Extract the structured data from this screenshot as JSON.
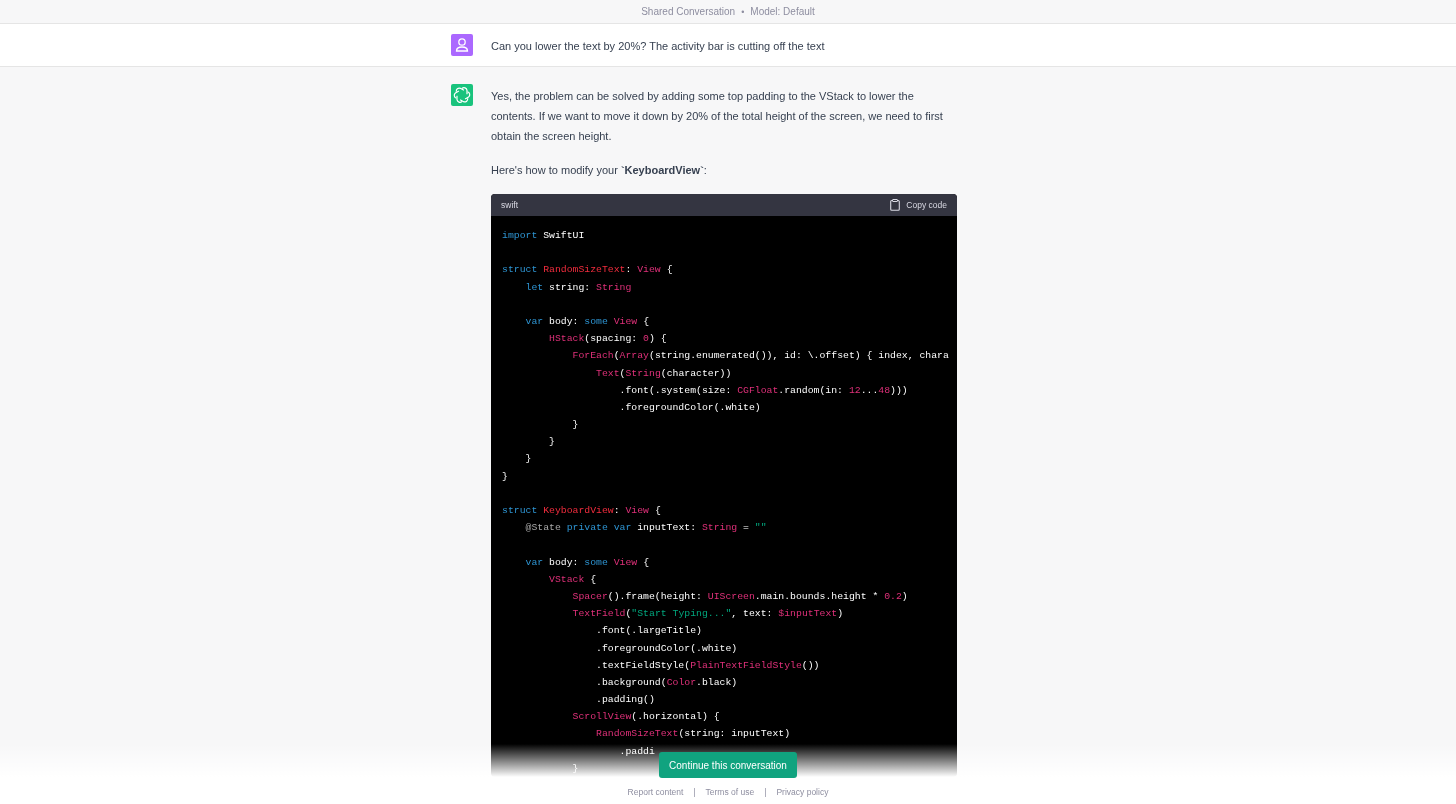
{
  "header": {
    "title": "Shared Conversation",
    "separator": "•",
    "model": "Model: Default"
  },
  "messages": [
    {
      "kind": "user",
      "paragraphs": [
        "Can you lower the text by 20%? The activity bar is cutting off the text"
      ]
    },
    {
      "kind": "assistant",
      "paragraphs": [
        "Yes, the problem can be solved by adding some top padding to the VStack to lower the contents. If we want to move it down by 20% of the total height of the screen, we need to first obtain the screen height.",
        "Here's how to modify your **`KeyboardView`**:"
      ],
      "code": {
        "language": "swift",
        "copy_label": "Copy code",
        "lines": [
          {
            "kind": "code",
            "tokens": [
              {
                "text": "import",
                "kind": "keyword"
              },
              {
                "text": " SwiftUI",
                "kind": "plain"
              }
            ]
          },
          {
            "kind": "blank"
          },
          {
            "kind": "code",
            "tokens": [
              {
                "text": "struct ",
                "kind": "keyword"
              },
              {
                "text": "RandomSizeText",
                "kind": "title"
              },
              {
                "text": ": ",
                "kind": "plain"
              },
              {
                "text": "View",
                "kind": "type"
              },
              {
                "text": " {",
                "kind": "plain"
              }
            ]
          },
          {
            "kind": "code",
            "tokens": [
              {
                "text": "    let",
                "kind": "keyword"
              },
              {
                "text": " string: ",
                "kind": "plain"
              },
              {
                "text": "String",
                "kind": "type"
              }
            ]
          },
          {
            "kind": "blank"
          },
          {
            "kind": "code",
            "tokens": [
              {
                "text": "    var",
                "kind": "keyword"
              },
              {
                "text": " body: ",
                "kind": "plain"
              },
              {
                "text": "some ",
                "kind": "keyword"
              },
              {
                "text": "View",
                "kind": "type"
              },
              {
                "text": " {",
                "kind": "plain"
              }
            ]
          },
          {
            "kind": "code",
            "tokens": [
              {
                "text": "        HStack",
                "kind": "type"
              },
              {
                "text": "(spacing: ",
                "kind": "plain"
              },
              {
                "text": "0",
                "kind": "type"
              },
              {
                "text": ") {",
                "kind": "plain"
              }
            ]
          },
          {
            "kind": "code",
            "tokens": [
              {
                "text": "            ForEach",
                "kind": "type"
              },
              {
                "text": "(",
                "kind": "plain"
              },
              {
                "text": "Array",
                "kind": "type"
              },
              {
                "text": "(string.enumerated()), id: \\.offset) { index, chara",
                "kind": "plain"
              }
            ]
          },
          {
            "kind": "code",
            "tokens": [
              {
                "text": "                Text",
                "kind": "type"
              },
              {
                "text": "(",
                "kind": "plain"
              },
              {
                "text": "String",
                "kind": "type"
              },
              {
                "text": "(character))",
                "kind": "plain"
              }
            ]
          },
          {
            "kind": "code",
            "tokens": [
              {
                "text": "                    .font(.system(size: ",
                "kind": "plain"
              },
              {
                "text": "CGFloat",
                "kind": "type"
              },
              {
                "text": ".random(in: ",
                "kind": "plain"
              },
              {
                "text": "12",
                "kind": "type"
              },
              {
                "text": "...",
                "kind": "plain"
              },
              {
                "text": "48",
                "kind": "type"
              },
              {
                "text": ")))",
                "kind": "plain"
              }
            ]
          },
          {
            "kind": "code",
            "tokens": [
              {
                "text": "                    .foregroundColor(.white)",
                "kind": "plain"
              }
            ]
          },
          {
            "kind": "code",
            "tokens": [
              {
                "text": "            }",
                "kind": "plain"
              }
            ]
          },
          {
            "kind": "code",
            "tokens": [
              {
                "text": "        }",
                "kind": "plain"
              }
            ]
          },
          {
            "kind": "code",
            "tokens": [
              {
                "text": "    }",
                "kind": "plain"
              }
            ]
          },
          {
            "kind": "code",
            "tokens": [
              {
                "text": "}",
                "kind": "plain"
              }
            ]
          },
          {
            "kind": "blank"
          },
          {
            "kind": "code",
            "tokens": [
              {
                "text": "struct ",
                "kind": "keyword"
              },
              {
                "text": "KeyboardView",
                "kind": "title"
              },
              {
                "text": ": ",
                "kind": "plain"
              },
              {
                "text": "View",
                "kind": "type"
              },
              {
                "text": " {",
                "kind": "plain"
              }
            ]
          },
          {
            "kind": "code",
            "tokens": [
              {
                "text": "    @State ",
                "kind": "meta"
              },
              {
                "text": "private var",
                "kind": "keyword"
              },
              {
                "text": " inputText: ",
                "kind": "plain"
              },
              {
                "text": "String",
                "kind": "type"
              },
              {
                "text": " = ",
                "kind": "plain"
              },
              {
                "text": "\"\"",
                "kind": "string"
              }
            ]
          },
          {
            "kind": "blank"
          },
          {
            "kind": "code",
            "tokens": [
              {
                "text": "    var",
                "kind": "keyword"
              },
              {
                "text": " body: ",
                "kind": "plain"
              },
              {
                "text": "some ",
                "kind": "keyword"
              },
              {
                "text": "View",
                "kind": "type"
              },
              {
                "text": " {",
                "kind": "plain"
              }
            ]
          },
          {
            "kind": "code",
            "tokens": [
              {
                "text": "        VStack",
                "kind": "type"
              },
              {
                "text": " {",
                "kind": "plain"
              }
            ]
          },
          {
            "kind": "code",
            "tokens": [
              {
                "text": "            Spacer",
                "kind": "type"
              },
              {
                "text": "().frame(height: ",
                "kind": "plain"
              },
              {
                "text": "UIScreen",
                "kind": "type"
              },
              {
                "text": ".main.bounds.height * ",
                "kind": "plain"
              },
              {
                "text": "0.2",
                "kind": "type"
              },
              {
                "text": ")",
                "kind": "plain"
              }
            ]
          },
          {
            "kind": "code",
            "tokens": [
              {
                "text": "            TextField",
                "kind": "type"
              },
              {
                "text": "(",
                "kind": "plain"
              },
              {
                "text": "\"Start Typing...\"",
                "kind": "string"
              },
              {
                "text": ", text: ",
                "kind": "plain"
              },
              {
                "text": "$inputText",
                "kind": "type"
              },
              {
                "text": ")",
                "kind": "plain"
              }
            ]
          },
          {
            "kind": "code",
            "tokens": [
              {
                "text": "                .font(.largeTitle)",
                "kind": "plain"
              }
            ]
          },
          {
            "kind": "code",
            "tokens": [
              {
                "text": "                .foregroundColor(.white)",
                "kind": "plain"
              }
            ]
          },
          {
            "kind": "code",
            "tokens": [
              {
                "text": "                .textFieldStyle(",
                "kind": "plain"
              },
              {
                "text": "PlainTextFieldStyle",
                "kind": "type"
              },
              {
                "text": "())",
                "kind": "plain"
              }
            ]
          },
          {
            "kind": "code",
            "tokens": [
              {
                "text": "                .background(",
                "kind": "plain"
              },
              {
                "text": "Color",
                "kind": "type"
              },
              {
                "text": ".black)",
                "kind": "plain"
              }
            ]
          },
          {
            "kind": "code",
            "tokens": [
              {
                "text": "                .padding()",
                "kind": "plain"
              }
            ]
          },
          {
            "kind": "code",
            "tokens": [
              {
                "text": "            ScrollView",
                "kind": "type"
              },
              {
                "text": "(.horizontal) {",
                "kind": "plain"
              }
            ]
          },
          {
            "kind": "code",
            "tokens": [
              {
                "text": "                RandomSizeText",
                "kind": "type"
              },
              {
                "text": "(string: inputText)",
                "kind": "plain"
              }
            ]
          },
          {
            "kind": "code",
            "tokens": [
              {
                "text": "                    .paddi",
                "kind": "plain"
              }
            ]
          },
          {
            "kind": "code",
            "tokens": [
              {
                "text": "            }",
                "kind": "plain"
              }
            ]
          }
        ]
      }
    }
  ],
  "continue_button": "Continue this conversation",
  "footer": {
    "links": [
      "Report content",
      "Terms of use",
      "Privacy policy"
    ],
    "separator": "|"
  }
}
